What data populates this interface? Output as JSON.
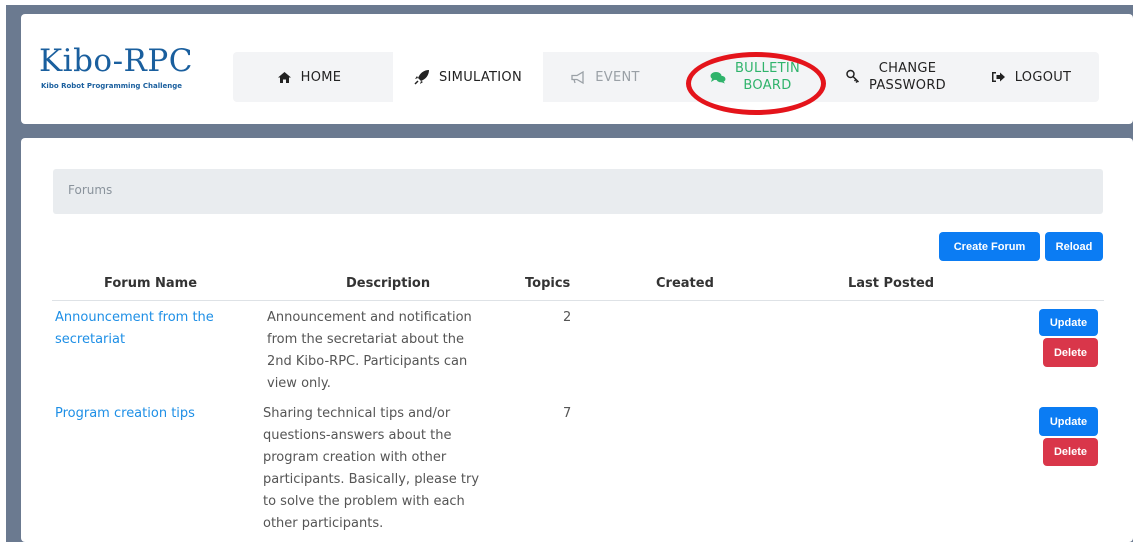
{
  "logo": {
    "title": "Kibo-RPC",
    "subtitle": "Kibo Robot Programming Challenge"
  },
  "nav": {
    "home": "HOME",
    "simulation": "SIMULATION",
    "event": "EVENT",
    "bulletin_line1": "BULLETIN",
    "bulletin_line2": "BOARD",
    "change_line1": "CHANGE",
    "change_line2": "PASSWORD",
    "logout": "LOGOUT"
  },
  "breadcrumb": "Forums",
  "actions": {
    "create_forum": "Create Forum",
    "reload": "Reload"
  },
  "table": {
    "headers": [
      "Forum Name",
      "Description",
      "Topics",
      "Created",
      "Last Posted"
    ],
    "rows": [
      {
        "name_line1": "Announcement from the",
        "name_line2": "secretariat",
        "desc_lines": [
          "Announcement and notification",
          "from the secretariat about the",
          "2nd Kibo-RPC. Participants can",
          "view only."
        ],
        "topics": "2",
        "update": "Update",
        "delete": "Delete"
      },
      {
        "name_line1": "Program creation tips",
        "desc_lines": [
          "Sharing technical tips and/or",
          "questions-answers about the",
          "program creation with other",
          "participants. Basically, please try",
          "to solve the problem with each",
          "other participants."
        ],
        "topics": "7",
        "update": "Update",
        "delete": "Delete"
      }
    ]
  },
  "colors": {
    "brand": "#1a5f9e",
    "link": "#1e8fe6",
    "primary_button": "#0b7cf3",
    "danger_button": "#d9364a",
    "bulletin_active": "#2fb36b",
    "highlight_ring": "#e4141b"
  }
}
